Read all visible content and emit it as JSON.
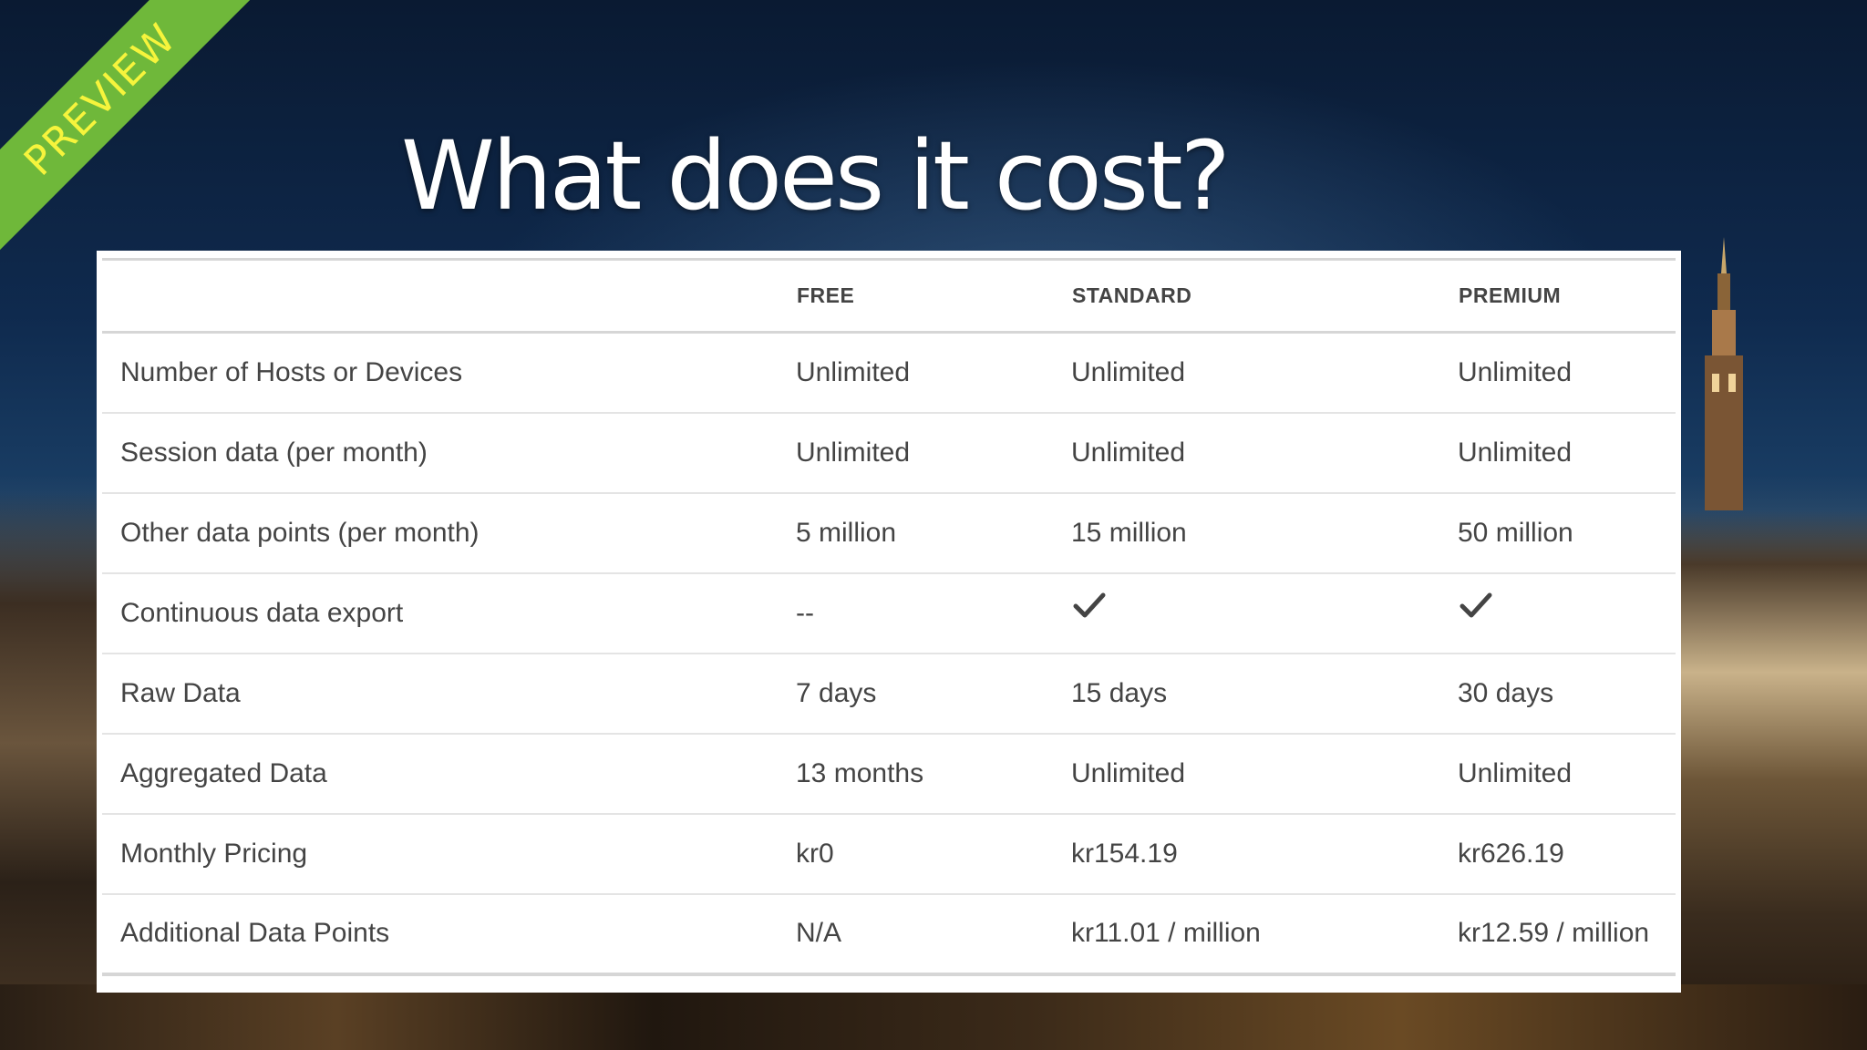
{
  "slide": {
    "badge": "PREVIEW",
    "title": "What does it cost?"
  },
  "table": {
    "columns": [
      "",
      "FREE",
      "STANDARD",
      "PREMIUM"
    ],
    "rows": [
      {
        "feature": "Number of Hosts or Devices",
        "free": "Unlimited",
        "standard": "Unlimited",
        "premium": "Unlimited"
      },
      {
        "feature": "Session data (per month)",
        "free": "Unlimited",
        "standard": "Unlimited",
        "premium": "Unlimited"
      },
      {
        "feature": "Other data points (per month)",
        "free": "5 million",
        "standard": "15 million",
        "premium": "50 million"
      },
      {
        "feature": "Continuous data export",
        "free": "--",
        "standard_icon": "checkmark-icon",
        "premium_icon": "checkmark-icon"
      },
      {
        "feature": "Raw Data",
        "free": "7 days",
        "standard": "15 days",
        "premium": "30 days"
      },
      {
        "feature": "Aggregated Data",
        "free": "13 months",
        "standard": "Unlimited",
        "premium": "Unlimited"
      },
      {
        "feature": "Monthly Pricing",
        "free": "kr0",
        "standard": "kr154.19",
        "premium": "kr626.19"
      },
      {
        "feature": "Additional Data Points",
        "free": "N/A",
        "standard": "kr11.01 / million",
        "premium": "kr12.59 / million"
      }
    ]
  },
  "colors": {
    "ribbon": "#6fb83a",
    "ribbon_text": "#f6f43c",
    "title": "#ffffff",
    "table_text": "#444444"
  }
}
